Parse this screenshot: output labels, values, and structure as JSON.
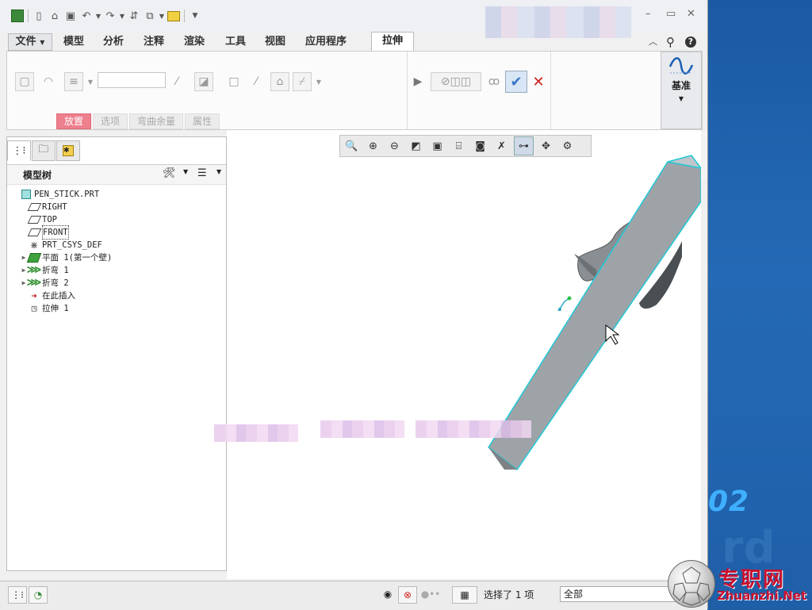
{
  "titlebar": {
    "quick_access": [
      "app-logo",
      "new-icon",
      "open-icon",
      "save-icon",
      "undo-icon",
      "redo-icon",
      "regenerate-icon",
      "windows-icon",
      "close-window-icon",
      "customize-icon"
    ],
    "window_controls": [
      "–",
      "▭",
      "✕"
    ]
  },
  "menubar": {
    "file": "文件",
    "tabs": [
      "模型",
      "分析",
      "注释",
      "渲染",
      "工具",
      "视图",
      "应用程序"
    ],
    "active_tab": "拉伸"
  },
  "ribbon": {
    "sub_tabs": [
      "放置",
      "选项",
      "弯曲余量",
      "属性"
    ],
    "datum_label": "基准"
  },
  "tree": {
    "title": "模型树",
    "items": [
      {
        "label": "PEN_STICK.PRT",
        "icon": "part-icon",
        "expand": false
      },
      {
        "label": "RIGHT",
        "icon": "datum-plane-icon",
        "expand": false
      },
      {
        "label": "TOP",
        "icon": "datum-plane-icon",
        "expand": false
      },
      {
        "label": "FRONT",
        "icon": "datum-plane-icon",
        "expand": false
      },
      {
        "label": "PRT_CSYS_DEF",
        "icon": "csys-icon",
        "expand": false
      },
      {
        "label": "平面 1(第一个壁)",
        "icon": "flat-wall-icon",
        "expand": true
      },
      {
        "label": "折弯 1",
        "icon": "bend-icon",
        "expand": true
      },
      {
        "label": "折弯 2",
        "icon": "bend-icon",
        "expand": true
      },
      {
        "label": "在此插入",
        "icon": "insert-arrow-icon",
        "expand": false
      },
      {
        "label": "拉伸 1",
        "icon": "extrude-icon",
        "expand": false
      }
    ]
  },
  "view_toolbar": [
    "refit-icon",
    "zoom-in-icon",
    "zoom-out-icon",
    "repaint-icon",
    "display-style-icon",
    "saved-views-icon",
    "view-manager-icon",
    "perspective-icon",
    "datum-display-icon",
    "spin-center-icon",
    "annotation-display-icon"
  ],
  "status": {
    "selection_text": "选择了 1 项",
    "filter_value": "全部"
  },
  "watermark": {
    "site_cn": "专职网",
    "site_en": "Zhuanzhi.Net"
  },
  "desktop": {
    "number": "02"
  },
  "colors": {
    "accent_active_tab": "#ee7f8d",
    "ok_check": "#3a78c8",
    "cancel_x": "#d0201f",
    "model_edge": "#1fc9d6"
  }
}
